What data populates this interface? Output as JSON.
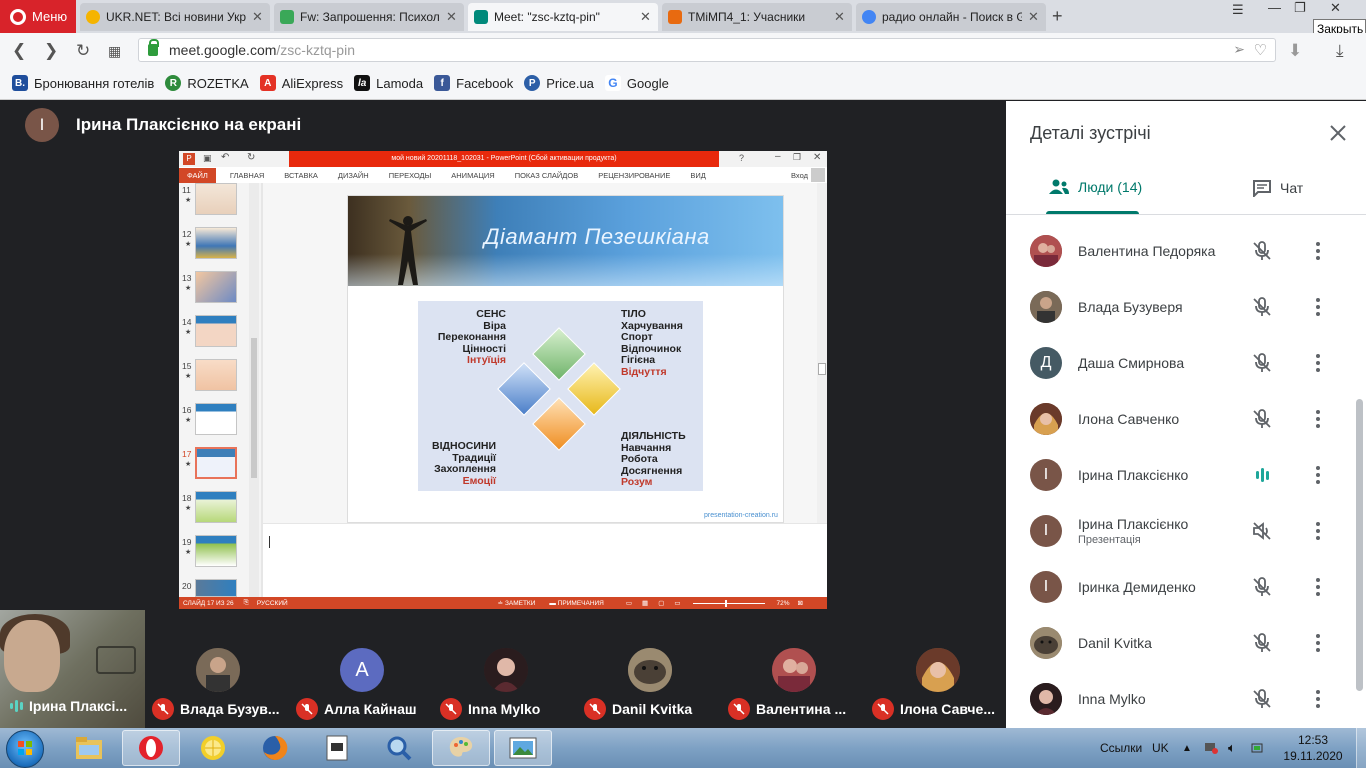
{
  "browser": {
    "menu_label": "Меню",
    "tabs": [
      {
        "label": "UKR.NET: Всі новини Укра",
        "fav_color": "#f5b400"
      },
      {
        "label": "Fw: Запрошення: Психоло",
        "fav_color": "#3aa858"
      },
      {
        "label": "Meet: \"zsc-kztq-pin\"",
        "fav_color": "#00897b"
      },
      {
        "label": "ТМіМП4_1: Учасники",
        "fav_color": "#e86a10"
      },
      {
        "label": "радио онлайн - Поиск в G",
        "fav_color": "#4285f4"
      }
    ],
    "tooltip": "Закрыть",
    "url_host": "meet.google.com",
    "url_path": "/zsc-kztq-pin",
    "bookmarks": [
      {
        "label": "Бронювання готелів",
        "icon": "B.",
        "color": "#1f4e9c"
      },
      {
        "label": "ROZETKA",
        "icon": "R",
        "color": "#2e8b3c"
      },
      {
        "label": "AliExpress",
        "icon": "A",
        "color": "#e43225"
      },
      {
        "label": "Lamoda",
        "icon": "la",
        "color": "#111111"
      },
      {
        "label": "Facebook",
        "icon": "f",
        "color": "#3b5998"
      },
      {
        "label": "Price.ua",
        "icon": "P",
        "color": "#2d5fa7"
      },
      {
        "label": "Google",
        "icon": "G",
        "color": "#4285f4"
      }
    ]
  },
  "meet": {
    "presenter_initial": "І",
    "presenter_title": "Ірина Плаксієнко на екрані",
    "ppt": {
      "window_title": "мой новий 20201118_102031 - PowerPoint (Сбой активации продукта)",
      "menu": [
        "ФАЙЛ",
        "ГЛАВНАЯ",
        "ВСТАВКА",
        "ДИЗАЙН",
        "ПЕРЕХОДЫ",
        "АНИМАЦИЯ",
        "ПОКАЗ СЛАЙДОВ",
        "РЕЦЕНЗИРОВАНИЕ",
        "ВИД"
      ],
      "signin": "Вход",
      "thumb_numbers": [
        "11",
        "12",
        "13",
        "14",
        "15",
        "16",
        "17",
        "18",
        "19",
        "20"
      ],
      "selected_slide": "17",
      "slide": {
        "title": "Діамант   Пезешкіана",
        "quadrants": {
          "top_left": [
            "СЕНС",
            "Віра",
            "Переконання",
            "Цінності"
          ],
          "top_left_accent": "Інтуїція",
          "top_right": [
            "ТІЛО",
            "Харчування",
            "Спорт",
            "Відпочинок",
            "Гігієна"
          ],
          "top_right_accent": "Відчуття",
          "bottom_left": [
            "ВІДНОСИНИ",
            "Традиції",
            "Захоплення"
          ],
          "bottom_left_accent": "Емоції",
          "bottom_right": [
            "ДІЯЛЬНІСТЬ",
            "Навчання",
            "Робота",
            "Досягнення"
          ],
          "bottom_right_accent": "Розум"
        },
        "footer": "presentation-creation.ru"
      },
      "status": {
        "slide_info": "СЛАЙД 17 ИЗ 26",
        "language": "РУССКИЙ",
        "notes": "ЗАМЕТКИ",
        "comments": "ПРИМЕЧАНИЯ",
        "zoom": "72%"
      }
    },
    "filmstrip": {
      "self_label": "Ірина Плаксі...",
      "participants": [
        {
          "label": "Влада Бузув...",
          "avatar": "",
          "color": "#5a4a3e"
        },
        {
          "label": "Алла Кайнаш",
          "avatar": "А",
          "color": "#5c6bc0"
        },
        {
          "label": "Inna Mylko",
          "avatar": "",
          "color": "#3a2a2c"
        },
        {
          "label": "Danil Kvitka",
          "avatar": "",
          "color": "#8a7a60"
        },
        {
          "label": "Валентина ...",
          "avatar": "",
          "color": "#6a3a3a"
        },
        {
          "label": "Ілона Савче...",
          "avatar": "",
          "color": "#8a5a40"
        }
      ]
    }
  },
  "panel": {
    "title": "Деталі зустрічі",
    "tab_people": "Люди (14)",
    "tab_chat": "Чат",
    "accent": "#00796b",
    "people": [
      {
        "name": "Валентина Педоряка",
        "sub": "",
        "avatar": "",
        "color": "#7a4a4a",
        "mic": "muted"
      },
      {
        "name": "Влада Бузуверя",
        "sub": "",
        "avatar": "",
        "color": "#5a4a3e",
        "mic": "muted"
      },
      {
        "name": "Даша Смирнова",
        "sub": "",
        "avatar": "Д",
        "color": "#455a64",
        "mic": "muted"
      },
      {
        "name": "Ілона Савченко",
        "sub": "",
        "avatar": "",
        "color": "#8a5a40",
        "mic": "muted"
      },
      {
        "name": "Ірина Плаксієнко",
        "sub": "",
        "avatar": "І",
        "color": "#795548",
        "mic": "speaking"
      },
      {
        "name": "Ірина Плаксієнко",
        "sub": "Презентація",
        "avatar": "І",
        "color": "#795548",
        "mic": "volume-off"
      },
      {
        "name": "Іринка Демиденко",
        "sub": "",
        "avatar": "І",
        "color": "#795548",
        "mic": "muted"
      },
      {
        "name": "Danil Kvitka",
        "sub": "",
        "avatar": "",
        "color": "#8a7a60",
        "mic": "muted"
      },
      {
        "name": "Inna Mylko",
        "sub": "",
        "avatar": "",
        "color": "#3a2a2c",
        "mic": "muted"
      }
    ]
  },
  "taskbar": {
    "links_label": "Ссылки",
    "lang": "UK",
    "time": "12:53",
    "date": "19.11.2020"
  }
}
